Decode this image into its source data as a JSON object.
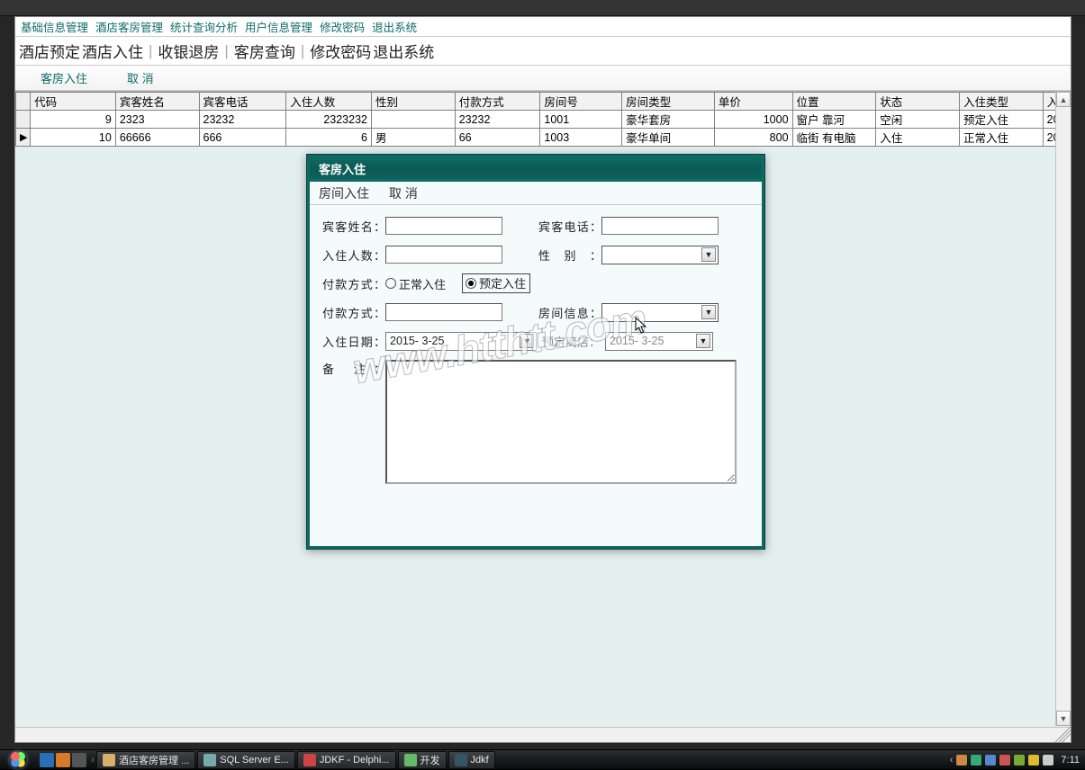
{
  "menu": {
    "items": [
      "基础信息管理",
      "酒店客房管理",
      "统计查询分析",
      "用户信息管理",
      "修改密码",
      "退出系统"
    ]
  },
  "toolbar": {
    "items": [
      "酒店预定",
      "酒店入住",
      "收银退房",
      "客房查询",
      "修改密码",
      "退出系统"
    ]
  },
  "subtoolbar": {
    "checkin": "客房入住",
    "cancel": "取 消"
  },
  "grid": {
    "headers": [
      "代码",
      "宾客姓名",
      "宾客电话",
      "入住人数",
      "性别",
      "付款方式",
      "房间号",
      "房间类型",
      "单价",
      "位置",
      "状态",
      "入住类型",
      "入"
    ],
    "rows": [
      {
        "indicator": "",
        "code": "9",
        "name": "2323",
        "phone": "23232",
        "count": "2323232",
        "sex": "",
        "pay": "23232",
        "room": "1001",
        "type": "豪华套房",
        "price": "1000",
        "loc": "窗户 靠河",
        "status": "空闲",
        "intype": "预定入住",
        "extra": "20"
      },
      {
        "indicator": "▶",
        "code": "10",
        "name": "66666",
        "phone": "666",
        "count": "6",
        "sex": "男",
        "pay": "66",
        "room": "1003",
        "type": "豪华单间",
        "price": "800",
        "loc": "临街 有电脑",
        "status": "入住",
        "intype": "正常入住",
        "extra": "20"
      }
    ]
  },
  "dialog": {
    "title": "客房入住",
    "menu": {
      "checkin": "房间入住",
      "cancel": "取 消"
    },
    "labels": {
      "guest_name": "宾客姓名：",
      "guest_phone": "宾客电话：",
      "count": "入住人数：",
      "sex": "性别：",
      "pay_mode": "付款方式：",
      "pay_mode2": "付款方式：",
      "room_info": "房间信息：",
      "checkin_date": "入住日期：",
      "due_date": "预定离店：",
      "memo": "备    注："
    },
    "radios": {
      "normal": "正常入住",
      "reserved": "预定入住",
      "selected": "reserved"
    },
    "values": {
      "guest_name": "",
      "guest_phone": "",
      "count": "",
      "sex": "",
      "pay_mode2": "",
      "room_info": "",
      "checkin_date": "2015- 3-25",
      "due_date": "2015- 3-25",
      "memo": ""
    }
  },
  "watermark": "www.htthtt.com",
  "taskbar": {
    "items": [
      "酒店客房管理 ...",
      "SQL Server E...",
      "JDKF - Delphi...",
      "开发",
      "Jdkf"
    ],
    "clock": "7:11"
  }
}
